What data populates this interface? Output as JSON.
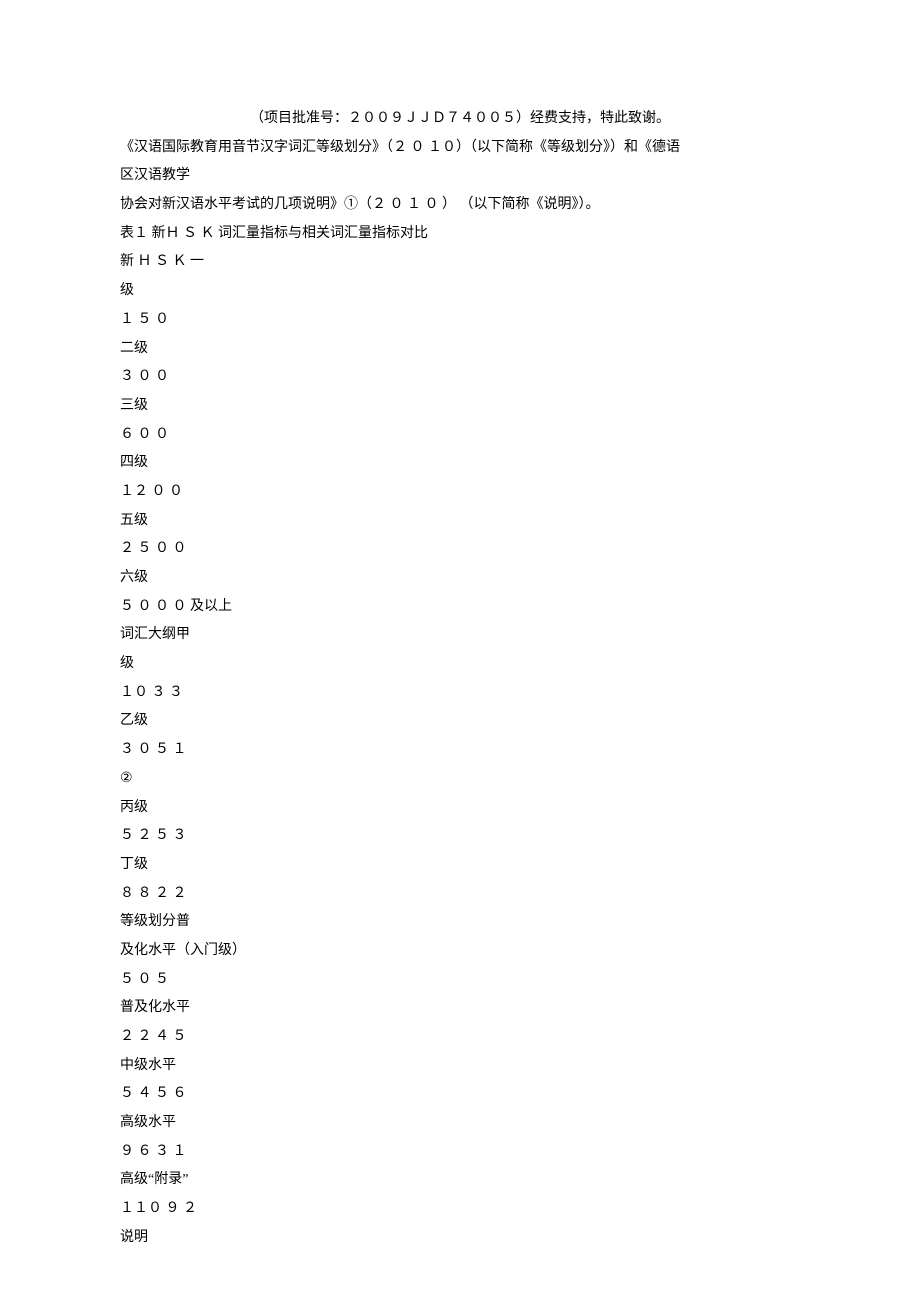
{
  "header_center": "（项目批准号：２００９ＪＪＤ７４００５）经费支持，特此致谢。",
  "lines": [
    "《汉语国际教育用音节汉字词汇等级划分》（２ ０ １０）（以下简称《等级划分》）和《德语",
    "区汉语教学",
    "协会对新汉语水平考试的几项说明》①（２ ０ １ ０ ） （以下简称《说明》）。",
    "表１ 新Ｈ Ｓ Ｋ 词汇量指标与相关词汇量指标对比",
    "新 Ｈ Ｓ Ｋ 一",
    "级",
    "１ ５ ０",
    "二级",
    "３ ０ ０",
    "三级",
    "６ ０ ０",
    "四级",
    "１２ ０ ０",
    "五级",
    "２ ５ ０ ０",
    "六级",
    "５ ０ ０ ０ 及以上",
    "词汇大纲甲",
    "级",
    "１０ ３ ３",
    "乙级",
    "３ ０ ５ １",
    "②",
    "丙级",
    "５ ２ ５ ３",
    "丁级",
    "８ ８ ２ ２",
    "等级划分普",
    "及化水平（入门级）",
    "５ ０ ５",
    "普及化水平",
    "２ ２ ４ ５",
    "中级水平",
    "５ ４ ５ ６",
    "高级水平",
    "９ ６ ３ １",
    "高级“附录”",
    "１１０ ９ ２",
    "说明"
  ]
}
